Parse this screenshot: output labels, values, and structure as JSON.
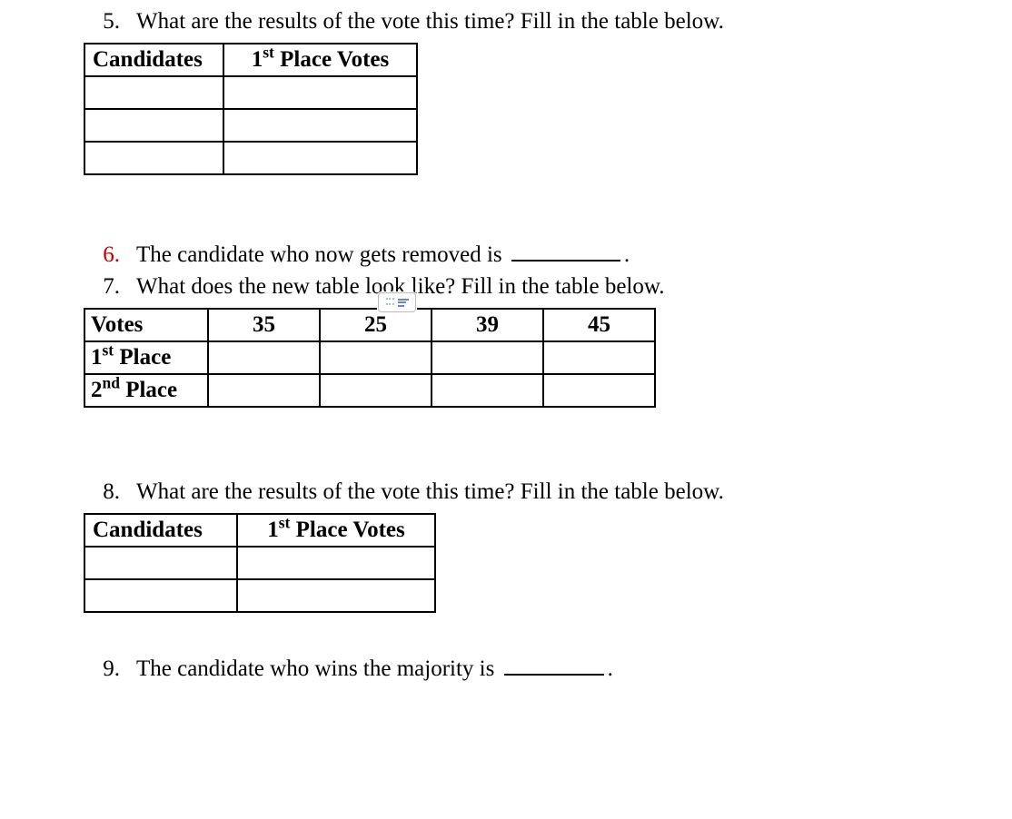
{
  "q5": {
    "number": "5.",
    "text": "What are the results of the vote this time? Fill in the table below."
  },
  "table5": {
    "headers": {
      "c1": "Candidates",
      "c2": "1",
      "c2_sup": "st",
      "c2_tail": " Place Votes"
    },
    "rows": [
      {
        "c1": "",
        "c2": ""
      },
      {
        "c1": "",
        "c2": ""
      },
      {
        "c1": "",
        "c2": ""
      }
    ]
  },
  "q6": {
    "number": "6.",
    "text_before": "The candidate who now gets removed is ",
    "text_after": "."
  },
  "q7": {
    "number": "7.",
    "text": "What does the new table look like? Fill in the table below."
  },
  "table7": {
    "row_labels": {
      "r1": "Votes",
      "r2_pre": "1",
      "r2_sup": "st",
      "r2_post": " Place",
      "r3_pre": "2",
      "r3_sup": "nd",
      "r3_post": " Place"
    },
    "votes": [
      "35",
      "25",
      "39",
      "45"
    ],
    "first_place": [
      "",
      "",
      "",
      ""
    ],
    "second_place": [
      "",
      "",
      "",
      ""
    ]
  },
  "q8": {
    "number": "8.",
    "text": "What are the results of the vote this time? Fill in the table below."
  },
  "table8": {
    "headers": {
      "c1": "Candidates",
      "c2": "1",
      "c2_sup": "st",
      "c2_tail": " Place Votes"
    },
    "rows": [
      {
        "c1": "",
        "c2": ""
      },
      {
        "c1": "",
        "c2": ""
      }
    ]
  },
  "q9": {
    "number": "9.",
    "text_before": "The candidate who wins the majority is ",
    "text_after": "."
  }
}
